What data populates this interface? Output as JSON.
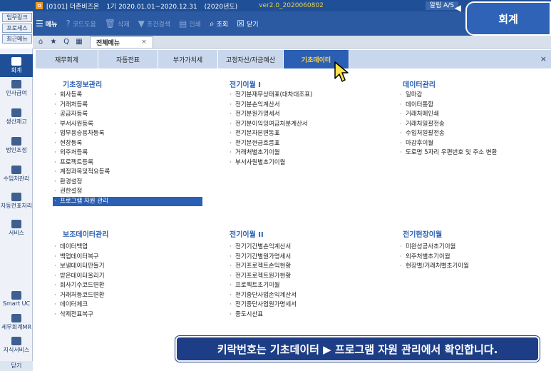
{
  "titlebar": {
    "company": "[0101] 더존비즈온",
    "period": "1기 2020.01.01~2020.12.31",
    "year": "(2020년도)",
    "version": "ver2.0_2020060802",
    "alarm": "알림 A/S"
  },
  "quick_buttons": [
    "업무링크",
    "프로세스",
    "최근메뉴"
  ],
  "toolbar": {
    "menu": "메뉴",
    "code_help": "코드도움",
    "delete": "삭제",
    "condition_search": "조건검색",
    "print": "인쇄",
    "lookup": "조회",
    "close": "닫기"
  },
  "badge": "회계",
  "doc_tab": "전체메뉴",
  "sidebar": {
    "items": [
      "회계",
      "인사급여",
      "생산재고",
      "법인조정",
      "수입처관리",
      "자동전표처리",
      "서비스",
      "Smart UC",
      "세무회계MR",
      "지식서비스"
    ],
    "close": "닫기"
  },
  "category_tabs": [
    "재무회계",
    "자동전표",
    "부가가치세",
    "고정자산/자금예산",
    "기초데이터"
  ],
  "sections": {
    "basic_info": {
      "title": "기초정보관리",
      "items": [
        "회사등록",
        "거래처등록",
        "공급자등록",
        "부서사원등록",
        "업무용승용차등록",
        "현장등록",
        "외주처등록",
        "프로젝트등록",
        "계정과목및적요등록",
        "환경설정",
        "권한설정",
        "프로그램 자원 관리"
      ]
    },
    "aux_data": {
      "title": "보조데이터관리",
      "items": [
        "데이터백업",
        "백업데이터복구",
        "보낼데이터만들기",
        "받은데이터올리기",
        "회사기수코드변환",
        "거래처등코드변환",
        "데이터체크",
        "삭제전표복구"
      ]
    },
    "prev_year_1": {
      "title": "전기이월 I",
      "items": [
        "전기분재무상태표(대차대조표)",
        "전기분손익계산서",
        "전기분원가명세서",
        "전기분이익잉여금처분계산서",
        "전기분자본변동표",
        "전기분현금흐름표",
        "거래처별초기이월",
        "부서사원별초기이월"
      ]
    },
    "prev_year_2": {
      "title": "전기이월 II",
      "items": [
        "전기기간별손익계산서",
        "전기기간별원가명세서",
        "전기프로젝트손익현황",
        "전기프로젝트원가현황",
        "프로젝트초기이월",
        "전기중단사업손익계산서",
        "전기중단사업원가명세서",
        "중도시산표"
      ]
    },
    "data_mgmt": {
      "title": "데이터관리",
      "items": [
        "일마감",
        "데이터통합",
        "거래처메인쇄",
        "거래처일괄전송",
        "수입처일괄전송",
        "마감후이월",
        "도로명 5자리 우편번호 및 주소 변환"
      ]
    },
    "prev_site": {
      "title": "전기현장이월",
      "items": [
        "미완성공사초기이월",
        "외주처별초기이월",
        "현장별/거래처별초기이월"
      ]
    }
  },
  "caption": "키락번호는 기초데이터 ▶ 프로그램 자원 관리에서 확인합니다."
}
